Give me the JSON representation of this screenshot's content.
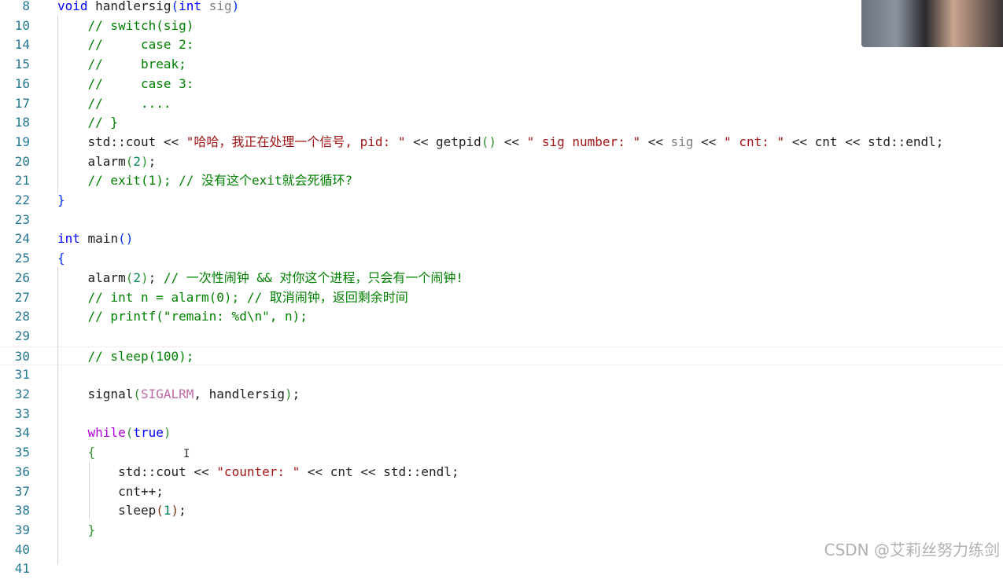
{
  "editor": {
    "lines": [
      {
        "n": "8",
        "tokens": [
          [
            "void",
            "kw"
          ],
          [
            " handlersig",
            "fn"
          ],
          [
            "(",
            "p1"
          ],
          [
            "int",
            "kw"
          ],
          [
            " ",
            "plain"
          ],
          [
            "sig",
            "param"
          ],
          [
            ")",
            "p1"
          ]
        ]
      },
      {
        "n": "10",
        "tokens": [
          [
            "    // switch(sig)",
            "com"
          ]
        ]
      },
      {
        "n": "14",
        "tokens": [
          [
            "    //     case 2:",
            "com"
          ]
        ]
      },
      {
        "n": "15",
        "tokens": [
          [
            "    //     break;",
            "com"
          ]
        ]
      },
      {
        "n": "16",
        "tokens": [
          [
            "    //     case 3:",
            "com"
          ]
        ]
      },
      {
        "n": "17",
        "tokens": [
          [
            "    //     ....",
            "com"
          ]
        ]
      },
      {
        "n": "18",
        "tokens": [
          [
            "    // }",
            "com"
          ]
        ]
      },
      {
        "n": "19",
        "tokens": [
          [
            "    std::cout << ",
            "plain"
          ],
          [
            "\"哈哈，我正在处理一个信号, pid: \"",
            "str"
          ],
          [
            " << getpid",
            "plain"
          ],
          [
            "()",
            "p2"
          ],
          [
            " << ",
            "plain"
          ],
          [
            "\" sig number: \"",
            "str"
          ],
          [
            " << ",
            "plain"
          ],
          [
            "sig",
            "param"
          ],
          [
            " << ",
            "plain"
          ],
          [
            "\" cnt: \"",
            "str"
          ],
          [
            " << cnt << std::endl;",
            "plain"
          ]
        ]
      },
      {
        "n": "20",
        "tokens": [
          [
            "    alarm",
            "plain"
          ],
          [
            "(",
            "p2"
          ],
          [
            "2",
            "num"
          ],
          [
            ")",
            "p2"
          ],
          [
            ";",
            "plain"
          ]
        ]
      },
      {
        "n": "21",
        "tokens": [
          [
            "    // exit(1); // 没有这个exit就会死循环?",
            "com"
          ]
        ]
      },
      {
        "n": "22",
        "tokens": [
          [
            "}",
            "p1"
          ]
        ]
      },
      {
        "n": "23",
        "tokens": []
      },
      {
        "n": "24",
        "tokens": [
          [
            "int",
            "kw"
          ],
          [
            " main",
            "plain"
          ],
          [
            "()",
            "p1"
          ]
        ]
      },
      {
        "n": "25",
        "tokens": [
          [
            "{",
            "p1"
          ]
        ]
      },
      {
        "n": "26",
        "tokens": [
          [
            "    alarm",
            "plain"
          ],
          [
            "(",
            "p2"
          ],
          [
            "2",
            "num"
          ],
          [
            ")",
            "p2"
          ],
          [
            "; ",
            "plain"
          ],
          [
            "// 一次性闹钟 && 对你这个进程，只会有一个闹钟!",
            "com"
          ]
        ]
      },
      {
        "n": "27",
        "tokens": [
          [
            "    // int n = alarm(0); // 取消闹钟，返回剩余时间",
            "com"
          ]
        ]
      },
      {
        "n": "28",
        "tokens": [
          [
            "    // printf(\"remain: %d\\n\", n);",
            "com"
          ]
        ]
      },
      {
        "n": "29",
        "tokens": []
      },
      {
        "n": "30",
        "tokens": [
          [
            "    // sleep(100);",
            "com"
          ]
        ]
      },
      {
        "n": "31",
        "tokens": []
      },
      {
        "n": "32",
        "tokens": [
          [
            "    signal",
            "plain"
          ],
          [
            "(",
            "p2"
          ],
          [
            "SIGALRM",
            "mac"
          ],
          [
            ", handlersig",
            "plain"
          ],
          [
            ")",
            "p2"
          ],
          [
            ";",
            "plain"
          ]
        ]
      },
      {
        "n": "33",
        "tokens": []
      },
      {
        "n": "34",
        "tokens": [
          [
            "    ",
            "plain"
          ],
          [
            "while",
            "ctl"
          ],
          [
            "(",
            "p2"
          ],
          [
            "true",
            "kw"
          ],
          [
            ")",
            "p2"
          ]
        ]
      },
      {
        "n": "35",
        "tokens": [
          [
            "    ",
            "plain"
          ],
          [
            "{",
            "p2"
          ]
        ]
      },
      {
        "n": "36",
        "tokens": [
          [
            "        std::cout << ",
            "plain"
          ],
          [
            "\"counter: \"",
            "str"
          ],
          [
            " << cnt << std::endl;",
            "plain"
          ]
        ]
      },
      {
        "n": "37",
        "tokens": [
          [
            "        cnt++;",
            "plain"
          ]
        ]
      },
      {
        "n": "38",
        "tokens": [
          [
            "        sleep",
            "plain"
          ],
          [
            "(",
            "p3"
          ],
          [
            "1",
            "num"
          ],
          [
            ")",
            "p3"
          ],
          [
            ";",
            "plain"
          ]
        ]
      },
      {
        "n": "39",
        "tokens": [
          [
            "    ",
            "plain"
          ],
          [
            "}",
            "p2"
          ]
        ]
      },
      {
        "n": "40",
        "tokens": []
      },
      {
        "n": "41",
        "tokens": []
      }
    ],
    "current_line": "30"
  },
  "watermark": "CSDN @艾莉丝努力练剑",
  "cursor_glyph": "I",
  "colors": {
    "keyword": "#0000ff",
    "string": "#a31515",
    "comment": "#008000",
    "macro": "#c06aa8",
    "line_number": "#237893"
  }
}
